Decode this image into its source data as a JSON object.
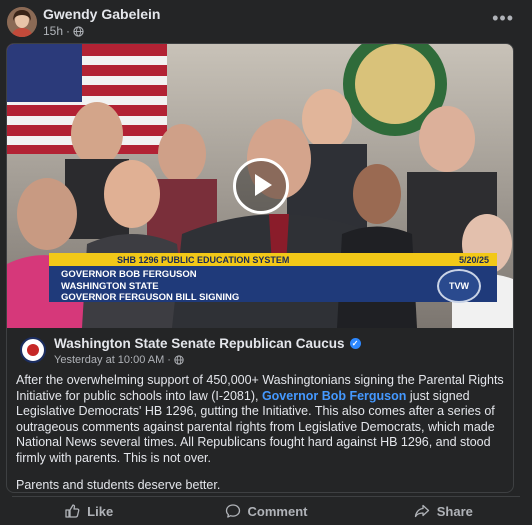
{
  "post": {
    "author": "Gwendy Gabelein",
    "time": "15h",
    "privacy_icon": "globe-icon",
    "more_icon": "more-horizontal-icon"
  },
  "video": {
    "lower_third": {
      "bill_title": "SHB 1296 PUBLIC EDUCATION SYSTEM",
      "date": "5/20/25",
      "line1": "GOVERNOR BOB FERGUSON",
      "line2": "WASHINGTON STATE",
      "line3": "GOVERNOR FERGUSON BILL SIGNING",
      "network": "TVW"
    },
    "play_icon": "play-icon"
  },
  "shared_post": {
    "page_name": "Washington State Senate Republican Caucus",
    "verified_icon": "verified-badge-icon",
    "timestamp": "Yesterday at 10:00 AM",
    "body_part1": "After the overwhelming support of 450,000+ Washingtonians signing the Parental Rights Initiative for public schools into law (I-2081), ",
    "link_text": "Governor Bob Ferguson",
    "body_part2": " just signed Legislative Democrats' HB 1296, gutting the Initiative. This also comes after a series of outrageous comments against parental rights from Legislative Democrats, which made National News several times. All Republicans fought hard against HB 1296, and stood firmly with parents. This is not over.",
    "body_paragraph2": "Parents and students deserve better."
  },
  "actions": {
    "like": "Like",
    "comment": "Comment",
    "share": "Share"
  },
  "colors": {
    "background": "#242526",
    "text": "#e4e6eb",
    "secondary_text": "#b0b3b8",
    "link": "#4599ff",
    "lower_third_yellow": "#f2c818",
    "lower_third_blue": "#1f3a7a"
  }
}
